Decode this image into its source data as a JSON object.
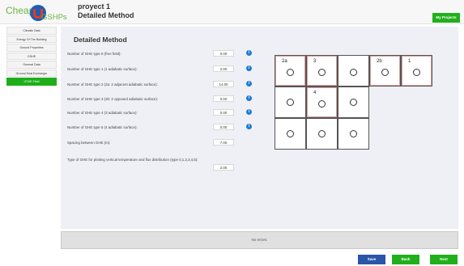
{
  "app": {
    "logo_text_1": "Cheap",
    "logo_text_2": "GSHPs",
    "project_name": "proyect 1",
    "page_title": "Detailed Method",
    "my_projects": "My Projects"
  },
  "sidebar": {
    "items": [
      {
        "label": "Climatic Data"
      },
      {
        "label": "Energy Of The Building"
      },
      {
        "label": "Ground Properties"
      },
      {
        "label": "GSHE"
      },
      {
        "label": "General Data"
      },
      {
        "label": "Ground Heat Exchanger"
      },
      {
        "label": "GSHE Field"
      }
    ],
    "active_index": 6
  },
  "main": {
    "title": "Detailed Method",
    "rows": [
      {
        "label": "Number of GHE type 0 (free field):",
        "value": "0.00",
        "info": true
      },
      {
        "label": "Number of GHE type 1 (1 adiabatic surface):",
        "value": "2.00",
        "info": true
      },
      {
        "label": "Number of GHE type 2 (2a: 2 adjacent adiabatic surface):",
        "value": "14.00",
        "info": true
      },
      {
        "label": "Number of GHE type 3 (2b: 2 opposed adiabatic surface):",
        "value": "0.00",
        "info": true
      },
      {
        "label": "Number of GHE type 4 (3 adiabatic surface):",
        "value": "0.00",
        "info": true
      },
      {
        "label": "Number of GHE type 5 (4 adiabatic surface):",
        "value": "0.00",
        "info": true
      },
      {
        "label": "Spacing between GHE (m):",
        "value": "7.00",
        "info": false
      }
    ],
    "plot_type_label": "Type of GHE for plotting vertical temperature and flux distribution (type 0,1,2,3,4,5):",
    "plot_type_value": "2.00"
  },
  "grid": {
    "cells": [
      {
        "label": "2a",
        "highlight": true
      },
      {
        "label": "3",
        "highlight": true
      },
      {
        "label": "",
        "highlight": false
      },
      {
        "label": "2b",
        "highlight": true
      },
      {
        "label": "1",
        "highlight": true
      },
      {
        "label": "",
        "highlight": false
      },
      {
        "label": "4",
        "highlight": true
      },
      {
        "label": "",
        "highlight": false
      },
      {
        "label": "",
        "highlight": false
      },
      {
        "label": "",
        "highlight": false
      },
      {
        "label": "",
        "highlight": false
      }
    ],
    "circle_symbol": "O"
  },
  "status": {
    "message": "No errors."
  },
  "footer": {
    "save_label": "Save",
    "back_label": "Back",
    "next_label": "Next"
  },
  "colors": {
    "accent_green": "#1fae1a",
    "save_blue": "#2a55a8",
    "info_blue": "#1f7bd4"
  },
  "icons": {
    "info": "info-icon",
    "logo": "logo-mark-icon"
  }
}
